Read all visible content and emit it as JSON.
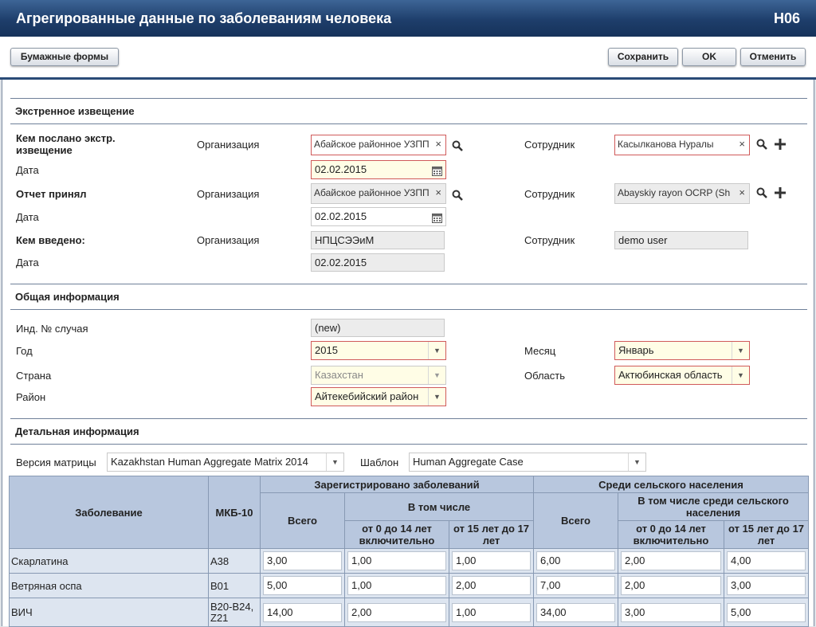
{
  "title": "Агрегированные данные по заболеваниям человека",
  "form_code": "H06",
  "toolbar": {
    "paper_forms": "Бумажные формы",
    "save": "Сохранить",
    "ok": "OK",
    "cancel": "Отменить"
  },
  "emergency": {
    "heading": "Экстренное извещение",
    "sent_by_label": "Кем послано экстр. извещение",
    "accepted_label": "Отчет принял",
    "entered_label": "Кем введено:",
    "org_label": "Организация",
    "employee_label": "Сотрудник",
    "date_label": "Дата",
    "sent_org": "Абайское районное УЗПП",
    "sent_employee": "Касылканова Нуралы",
    "sent_date": "02.02.2015",
    "accepted_org": "Абайское районное УЗПП",
    "accepted_employee": "Abayskiy rayon OCRP (Sh",
    "accepted_date": "02.02.2015",
    "entered_org": "НПЦСЭЭиМ",
    "entered_employee": "demo user",
    "entered_date": "02.02.2015"
  },
  "general": {
    "heading": "Общая информация",
    "case_no_label": "Инд. № случая",
    "case_no": "(new)",
    "year_label": "Год",
    "year": "2015",
    "month_label": "Месяц",
    "month": "Январь",
    "country_label": "Страна",
    "country": "Казахстан",
    "region_label": "Область",
    "region": "Актюбинская область",
    "district_label": "Район",
    "district": "Айтекебийский район"
  },
  "detail": {
    "heading": "Детальная информация",
    "matrix_label": "Версия матрицы",
    "matrix": "Kazakhstan Human Aggregate Matrix 2014",
    "template_label": "Шаблон",
    "template": "Human Aggregate Case"
  },
  "table": {
    "col_disease": "Заболевание",
    "col_icd": "МКБ-10",
    "grp_registered": "Зарегистрировано заболеваний",
    "grp_rural": "Среди сельского населения",
    "col_total": "Всего",
    "sub_including": "В том числе",
    "sub_rural_including": "В том числе среди сельского населения",
    "col_0_14": "от 0 до 14 лет включительно",
    "col_15_17": "от 15 лет до 17 лет",
    "rows": [
      {
        "disease": "Скарлатина",
        "icd": "A38",
        "v": [
          "3,00",
          "1,00",
          "1,00",
          "6,00",
          "2,00",
          "4,00"
        ]
      },
      {
        "disease": "Ветряная оспа",
        "icd": "B01",
        "v": [
          "5,00",
          "1,00",
          "2,00",
          "7,00",
          "2,00",
          "3,00"
        ]
      },
      {
        "disease": "ВИЧ",
        "icd": "B20-B24, Z21",
        "v": [
          "14,00",
          "2,00",
          "1,00",
          "34,00",
          "3,00",
          "5,00"
        ]
      }
    ]
  }
}
